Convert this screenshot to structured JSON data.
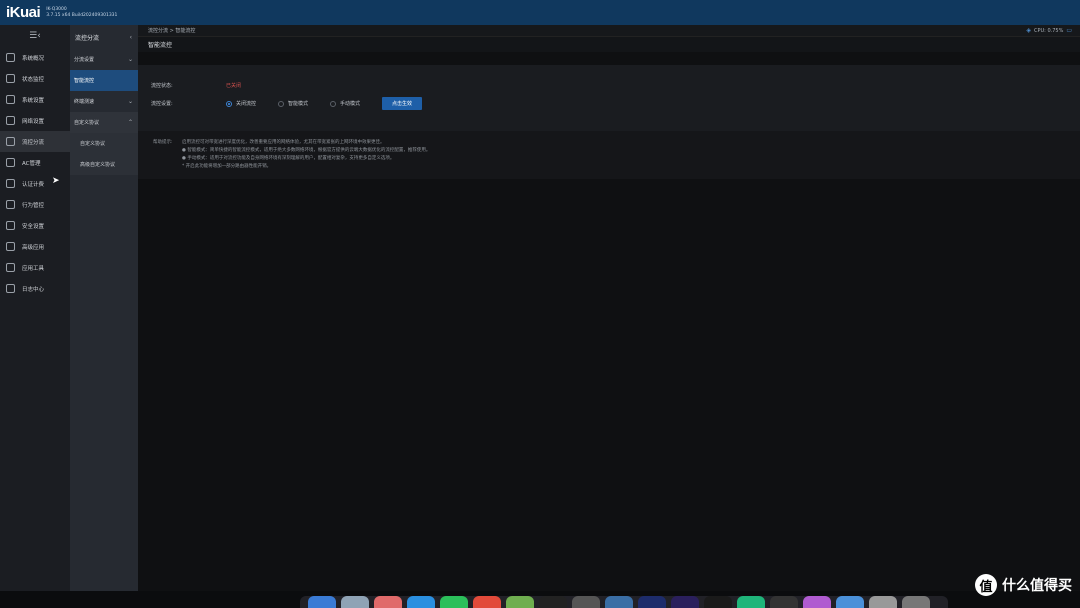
{
  "header": {
    "logo": "iKuai",
    "model": "IK-Q3000",
    "version": "3.7.15 x64 Build202409301331"
  },
  "nav": {
    "items": [
      {
        "label": "系统概况",
        "icon": "gauge-icon"
      },
      {
        "label": "状态监控",
        "icon": "monitor-icon"
      },
      {
        "label": "系统设置",
        "icon": "gear-icon"
      },
      {
        "label": "网络设置",
        "icon": "network-icon"
      },
      {
        "label": "流控分流",
        "icon": "flow-icon",
        "active": true
      },
      {
        "label": "AC管理",
        "icon": "wifi-icon"
      },
      {
        "label": "认证计费",
        "icon": "id-card-icon"
      },
      {
        "label": "行为管控",
        "icon": "arrows-icon"
      },
      {
        "label": "安全设置",
        "icon": "firewall-icon"
      },
      {
        "label": "高级应用",
        "icon": "advanced-icon"
      },
      {
        "label": "应用工具",
        "icon": "tools-icon"
      },
      {
        "label": "日志中心",
        "icon": "log-icon"
      }
    ]
  },
  "subnav": {
    "title": "流控分流",
    "items": [
      {
        "label": "分流设置"
      },
      {
        "label": "智能流控"
      },
      {
        "label": "终端测速"
      },
      {
        "label": "自定义协议"
      }
    ],
    "children": [
      {
        "label": "自定义协议"
      },
      {
        "label": "高级自定义协议"
      }
    ]
  },
  "breadcrumb": "流控分流 > 智能流控",
  "cpu": "CPU: 0.75%",
  "page_title": "智能流控",
  "form": {
    "status_label": "流控状态:",
    "status_value": "已关闭",
    "setting_label": "流控设置:",
    "options": [
      "关闭流控",
      "智能模式",
      "手动模式"
    ],
    "apply": "点击生效"
  },
  "help": {
    "label": "帮助提示:",
    "lines": [
      "启用流控可对带宽进行深度优化，改善重要应用的网络体验，尤其在带宽紧张的上网环境中效果更佳。",
      "● 智能模式：简单快捷的智能流控模式，适用于绝大多数网络环境，根据官方提供的云端大数据优化的流控配置，推荐使用。",
      "● 手动模式：适用于对流控功能及自身网络环境有深刻理解的用户，配置相对复杂，支持更多自定义选项。",
      "* 开启此功能将增加一部分路由器性能开销。"
    ]
  },
  "watermark": {
    "symbol": "值",
    "text": "什么值得买"
  },
  "colors": {
    "topbar": "#10385e",
    "accent": "#1e5fa8",
    "off": "#d9534f"
  }
}
